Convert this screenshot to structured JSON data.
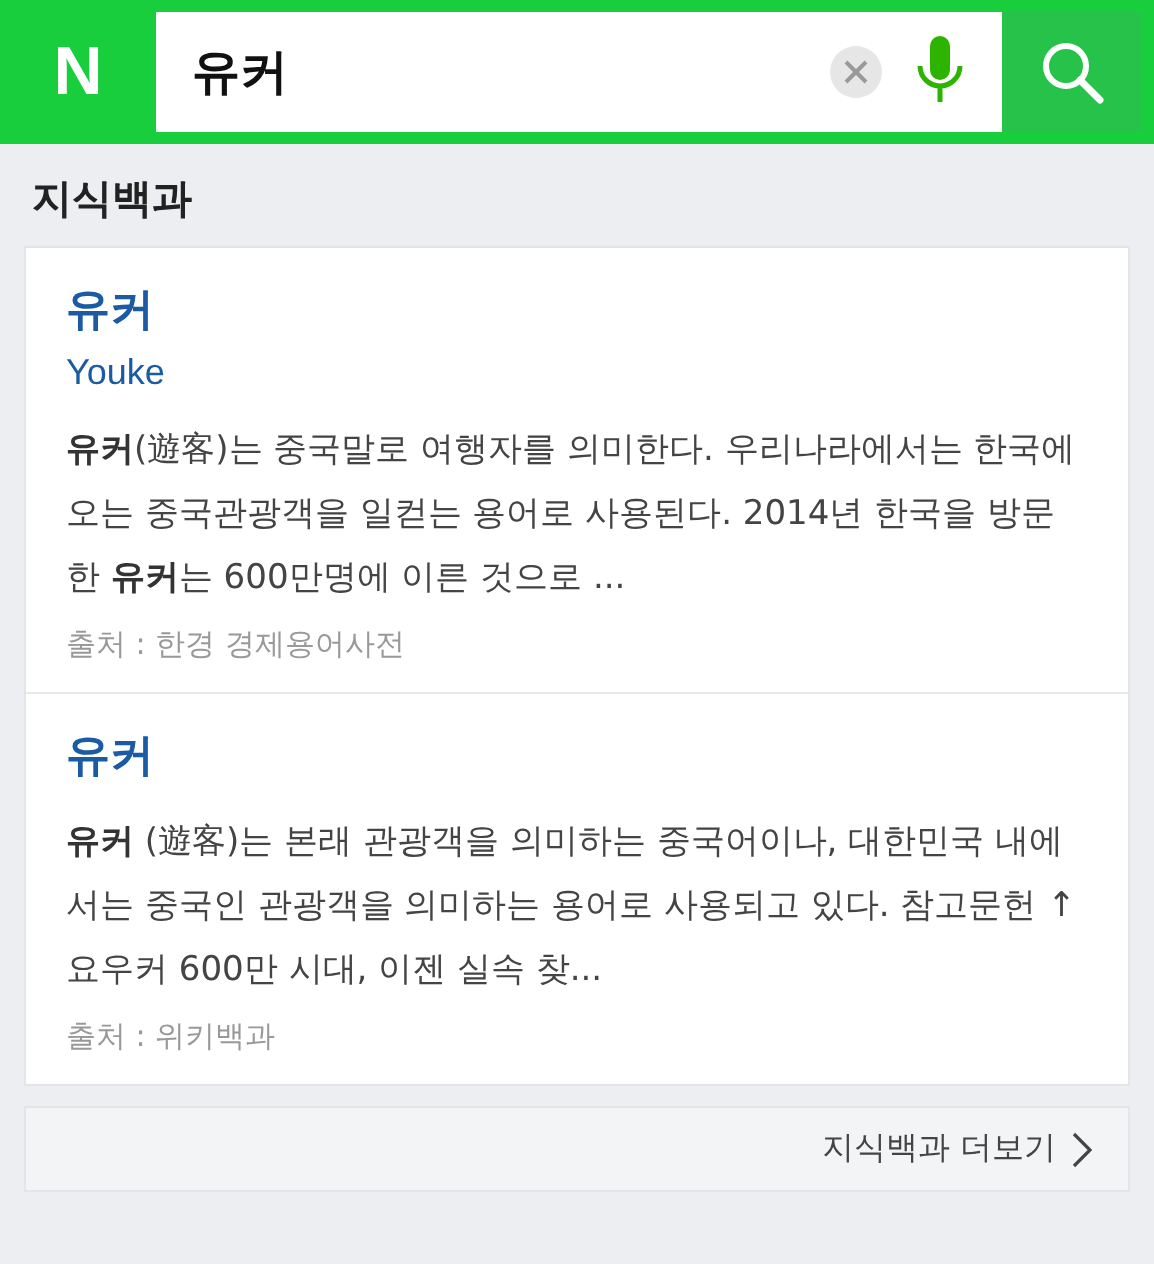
{
  "search": {
    "logo": "N",
    "query": "유커"
  },
  "section": {
    "title": "지식백과"
  },
  "results": [
    {
      "title": "유커",
      "subtitle": "Youke",
      "body": "**유커**(遊客)는 중국말로 여행자를 의미한다. 우리나라에서는 한국에 오는 중국관광객을 일컫는 용어로 사용된다. 2014년 한국을 방문한 **유커**는 600만명에 이른 것으로 ...",
      "source": "출처 : 한경 경제용어사전"
    },
    {
      "title": "유커",
      "body": "**유커** (遊客)는 본래 관광객을 의미하는 중국어이나, 대한민국 내에서는 중국인 관광객을 의미하는 용어로 사용되고 있다. 참고문헌 ↑ 요우커 600만 시대, 이젠 실속 찾...",
      "source": "출처 : 위키백과"
    }
  ],
  "more_link": "지식백과 더보기"
}
